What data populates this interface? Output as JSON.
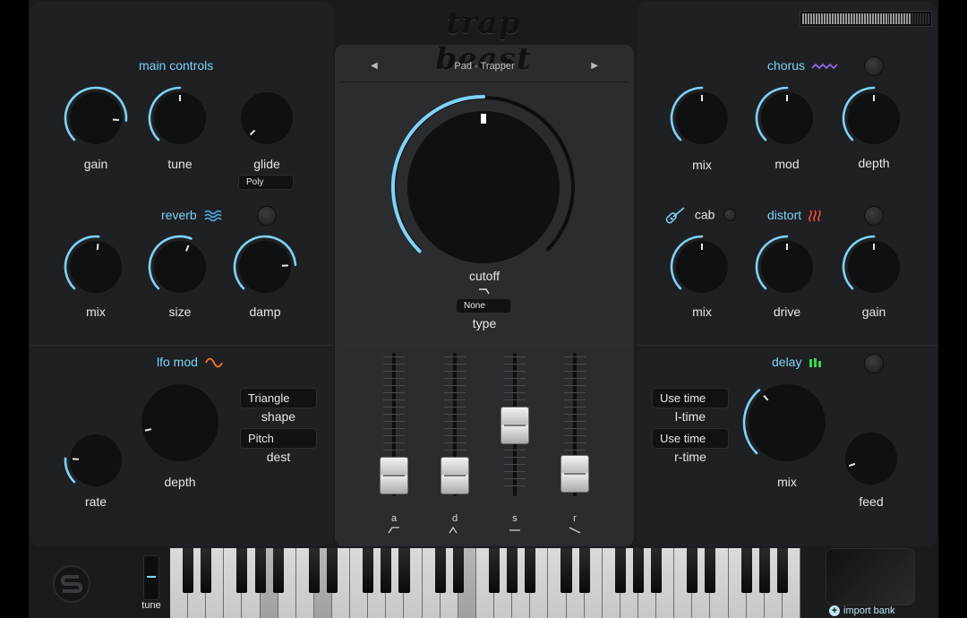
{
  "app": {
    "logo_text": "trap beast"
  },
  "colors": {
    "accent": "#7fd3f7",
    "chorus": "#9b6bf2",
    "distort": "#ff4b3b",
    "lfo": "#ff7a1a",
    "delay": "#37d84b"
  },
  "preset": {
    "name": "Pad - Trapper",
    "prev_icon": "triangle-left",
    "next_icon": "triangle-right"
  },
  "main_controls": {
    "title": "main controls",
    "gain": {
      "label": "gain",
      "value": 0.85
    },
    "tune": {
      "label": "tune",
      "value": 0.5
    },
    "glide": {
      "label": "glide",
      "value": 0.0
    },
    "voice_mode": "Poly"
  },
  "reverb": {
    "title": "reverb",
    "icon": "waves-icon",
    "mix": {
      "label": "mix",
      "value": 0.52
    },
    "size": {
      "label": "size",
      "value": 0.58
    },
    "damp": {
      "label": "damp",
      "value": 0.82
    }
  },
  "lfo_mod": {
    "title": "lfo mod",
    "icon": "sine-wave-icon",
    "rate": {
      "label": "rate",
      "value": 0.18
    },
    "depth": {
      "label": "depth",
      "value": 0.12
    },
    "shape": {
      "label": "shape",
      "value": "Triangle"
    },
    "dest": {
      "label": "dest",
      "value": "Pitch"
    }
  },
  "filter": {
    "cutoff": {
      "label": "cutoff",
      "value": 0.5
    },
    "type": {
      "label": "type",
      "value": "None"
    }
  },
  "envelope": {
    "attack": {
      "label": "a",
      "value": 0.1
    },
    "decay": {
      "label": "d",
      "value": 0.1
    },
    "sustain": {
      "label": "s",
      "value": 0.58
    },
    "release": {
      "label": "r",
      "value": 0.12
    }
  },
  "chorus": {
    "title": "chorus",
    "icon": "zigzag-wave-icon",
    "mix": {
      "label": "mix",
      "value": 0.5
    },
    "mod": {
      "label": "mod",
      "value": 0.5
    },
    "depth": {
      "label": "depth",
      "value": 0.5
    }
  },
  "cab": {
    "title": "cab",
    "icon": "guitar-icon"
  },
  "distort": {
    "title": "distort",
    "icon": "heat-icon",
    "mix": {
      "label": "mix",
      "value": 0.5
    },
    "drive": {
      "label": "drive",
      "value": 0.5
    },
    "gain": {
      "label": "gain",
      "value": 0.5
    }
  },
  "delay": {
    "title": "delay",
    "icon": "bars-icon",
    "l_time": {
      "label": "l-time",
      "value": "Use time"
    },
    "r_time": {
      "label": "r-time",
      "value": "Use time"
    },
    "mix": {
      "label": "mix",
      "value": 0.35
    },
    "feed": {
      "label": "feed",
      "value": 0.1
    }
  },
  "footer": {
    "tune_label": "tune",
    "import_bank": "import bank"
  }
}
